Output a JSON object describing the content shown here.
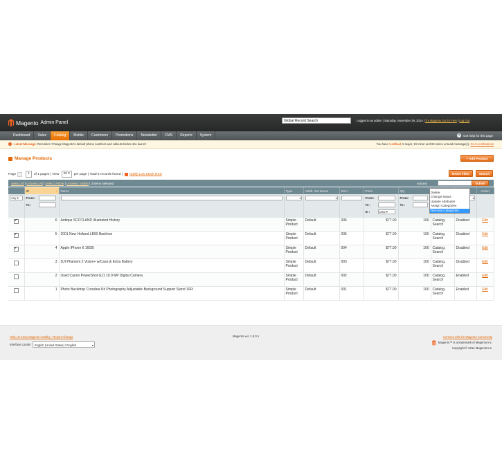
{
  "header": {
    "logo_text": "Magento",
    "logo_sub": "Admin Panel",
    "global_search_placeholder": "Global Record Search",
    "logged_in": "Logged in as admin",
    "date": "Saturday, November 29, 2014",
    "try_link": "Try Magento Go for Free",
    "logout": "Log Out"
  },
  "nav": {
    "items": [
      "Dashboard",
      "Sales",
      "Catalog",
      "Mobile",
      "Customers",
      "Promotions",
      "Newsletter",
      "CMS",
      "Reports",
      "System"
    ],
    "active": "Catalog",
    "help": "Get help for this page"
  },
  "message": {
    "label": "Latest Message:",
    "text": "Reminder: Change Magento's default phone numbers and callouts before site launch",
    "right_prefix": "You have",
    "critical": "1 critical",
    "right_mid": ", 5 major, 10 minor and 60 notice unread message(s).",
    "notifications_link": "Go to notifications"
  },
  "page": {
    "title": "Manage Products",
    "add_button": "Add Product"
  },
  "pager": {
    "page_label": "Page",
    "page_value": "1",
    "of_pages": "of 1 pages",
    "view_label": "View",
    "view_value": "20",
    "per_page": "per page",
    "total": "Total 6 records found",
    "rss_link": "Notify Low Stock RSS",
    "reset_button": "Reset Filter",
    "search_button": "Search"
  },
  "massaction": {
    "select_all": "Select All",
    "unselect_all": "Unselect All",
    "select_visible": "Select Visible",
    "unselect_visible": "Unselect Visible",
    "selected": "3 items selected",
    "actions_label": "Actions",
    "submit": "Submit",
    "options": [
      "Delete",
      "Change status",
      "Update Attributes",
      "Assign Categories",
      "Remove Categories"
    ],
    "selected_option": "Remove Categories"
  },
  "grid": {
    "columns": [
      "",
      "ID",
      "Name",
      "Type",
      "Attrib. Set Name",
      "SKU",
      "Price",
      "Qty",
      "",
      "",
      "Action"
    ],
    "filter": {
      "any": "Any",
      "from": "From:",
      "to": "To :",
      "in": "In :",
      "currency": "USD"
    },
    "rows": [
      {
        "checked": true,
        "id": "6",
        "name": "Antique SCOTLAND Illustrated History",
        "type": "Simple Product",
        "set": "Default",
        "sku": "006",
        "price": "$77.00",
        "qty": "100",
        "visibility": "Catalog, Search",
        "status": "Disabled",
        "action": "Edit"
      },
      {
        "checked": true,
        "id": "5",
        "name": "2001 New Holland LB90 Backhoe",
        "type": "Simple Product",
        "set": "Default",
        "sku": "005",
        "price": "$77.00",
        "qty": "100",
        "visibility": "Catalog, Search",
        "status": "Disabled",
        "action": "Edit"
      },
      {
        "checked": true,
        "id": "4",
        "name": "Apple iPhone 6 16GB",
        "type": "Simple Product",
        "set": "Default",
        "sku": "004",
        "price": "$77.00",
        "qty": "100",
        "visibility": "Catalog, Search",
        "status": "Disabled",
        "action": "Edit"
      },
      {
        "checked": false,
        "id": "3",
        "name": "DJI Phantom 2 Vision+ w/Case & Extra Battery",
        "type": "Simple Product",
        "set": "Default",
        "sku": "003",
        "price": "$77.00",
        "qty": "100",
        "visibility": "Catalog, Search",
        "status": "Disabled",
        "action": "Edit"
      },
      {
        "checked": false,
        "id": "2",
        "name": "Used Canon PowerShot G11 10.0 MP Digital Camera",
        "type": "Simple Product",
        "set": "Default",
        "sku": "002",
        "price": "$77.00",
        "qty": "100",
        "visibility": "Catalog, Search",
        "status": "Enabled",
        "action": "Edit"
      },
      {
        "checked": false,
        "id": "1",
        "name": "Photo Backdrop Crossbar Kit Photography Adjustable Background Support Stand 10Ft",
        "type": "Simple Product",
        "set": "Default",
        "sku": "001",
        "price": "$77.00",
        "qty": "100",
        "visibility": "Catalog, Search",
        "status": "Enabled",
        "action": "Edit"
      }
    ]
  },
  "footer": {
    "help_links": "Help Us Keep Magento Healthy - Report All Bugs",
    "locale_label": "Interface Locale:",
    "locale_value": "English (United States) / English",
    "version": "Magento ver. 1.9.0.1",
    "community": "Connect with the Magento Community",
    "trademark": "Magento™ is a trademark of Magento Inc.",
    "copyright": "Copyright © 2014 Magento Inc."
  }
}
